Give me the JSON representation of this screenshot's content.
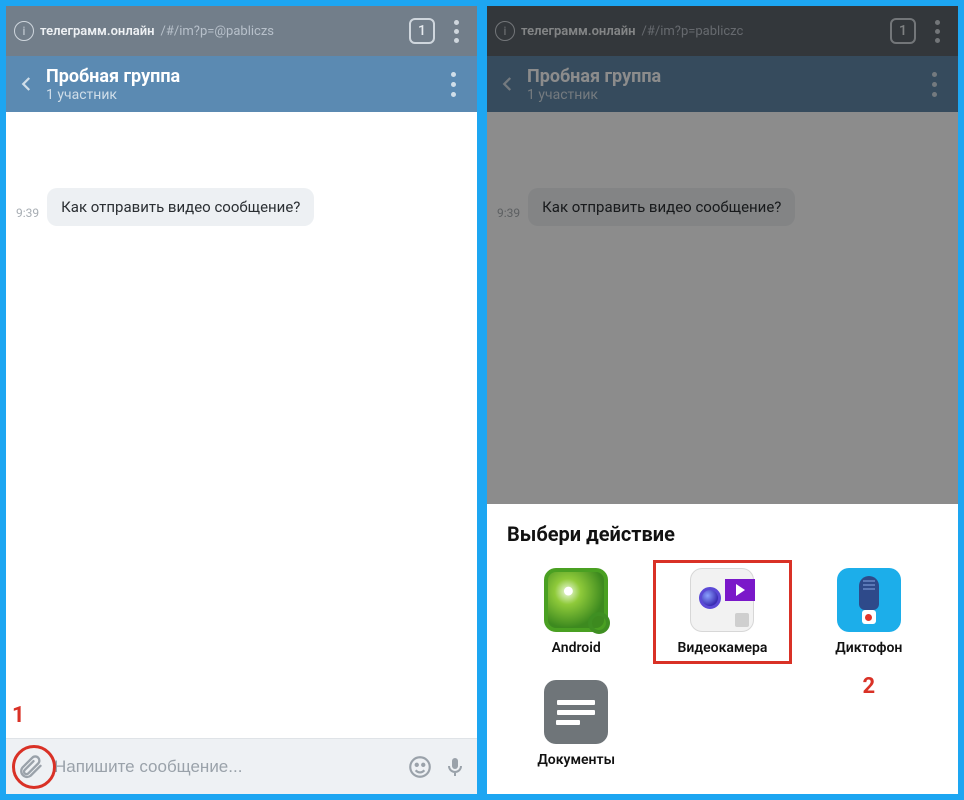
{
  "left": {
    "browser": {
      "url_main": "телеграмм.онлайн",
      "url_frag": "/#/im?p=@pabliczs",
      "tab_count": "1"
    },
    "chat": {
      "title": "Пробная группа",
      "subtitle": "1 участник"
    },
    "message": {
      "time": "9:39",
      "text": "Как отправить видео сообщение?"
    },
    "composer": {
      "placeholder": "Напишите сообщение..."
    },
    "annotation": "1"
  },
  "right": {
    "browser": {
      "url_main": "телеграмм.онлайн",
      "url_frag": "/#/im?p=pabliczc",
      "tab_count": "1"
    },
    "chat": {
      "title": "Пробная группа",
      "subtitle": "1 участник"
    },
    "message": {
      "time": "9:39",
      "text": "Как отправить видео сообщение?"
    },
    "sheet": {
      "title": "Выбери действие",
      "items": {
        "android": "Android",
        "camera": "Видеокамера",
        "recorder": "Диктофон",
        "documents": "Документы"
      }
    },
    "annotation": "2"
  }
}
